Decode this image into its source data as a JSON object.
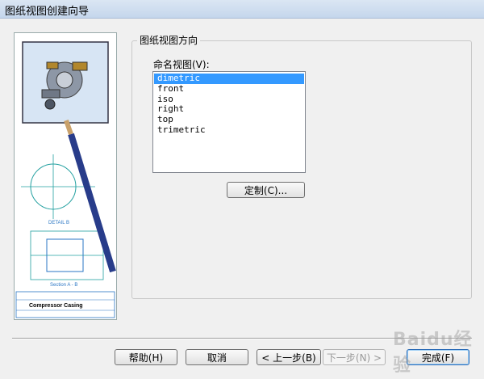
{
  "window": {
    "title": "图纸视图创建向导"
  },
  "illustration": {
    "detail_label": "DETAIL B",
    "section_label": "Section A - B",
    "title_block": "Compressor Casing"
  },
  "group": {
    "legend": "图纸视图方向"
  },
  "views": {
    "label": "命名视图(V):",
    "items": [
      "dimetric",
      "front",
      "iso",
      "right",
      "top",
      "trimetric"
    ],
    "selected": "dimetric"
  },
  "buttons": {
    "customize": "定制(C)...",
    "help": "帮助(H)",
    "cancel": "取消",
    "back": "< 上一步(B)",
    "next": "下一步(N) >",
    "finish": "完成(F)"
  },
  "watermark": "Baidu经验"
}
